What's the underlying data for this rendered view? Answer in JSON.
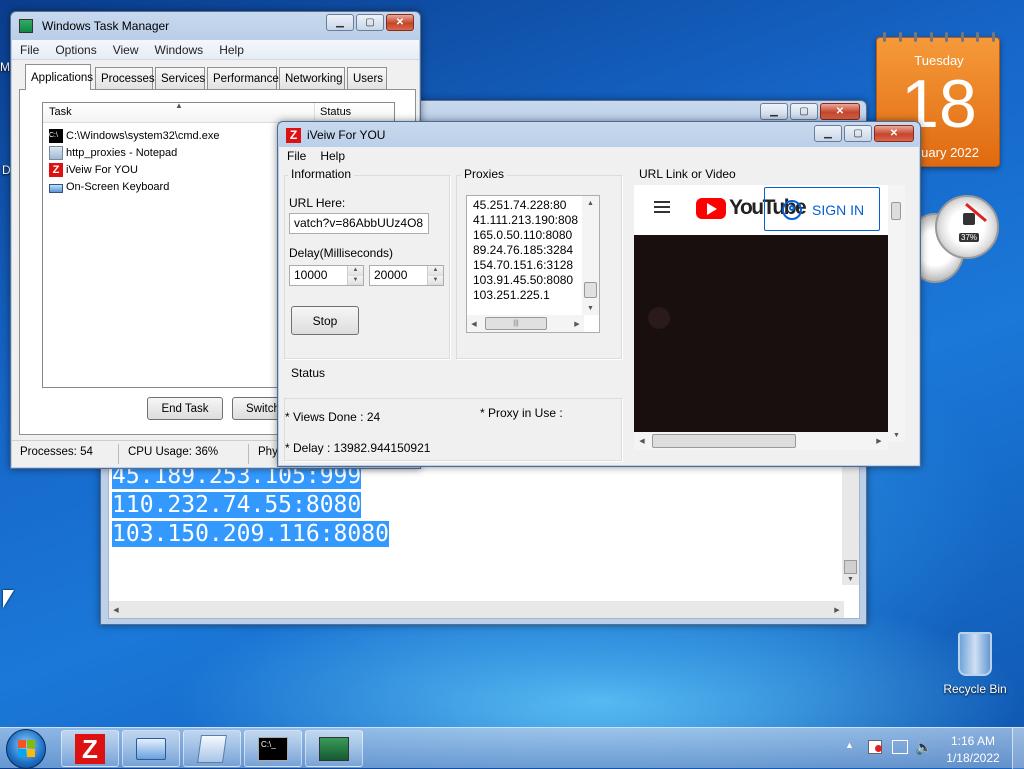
{
  "desktop": {
    "recycle_bin_label": "Recycle Bin",
    "calendar": {
      "day_name": "Tuesday",
      "day": "18",
      "month_year": "uary 2022"
    },
    "cpu_gauge_value": "37%",
    "edge_letters": [
      "M",
      "D"
    ]
  },
  "task_manager": {
    "title": "Windows Task Manager",
    "menu": [
      "File",
      "Options",
      "View",
      "Windows",
      "Help"
    ],
    "tabs": [
      "Applications",
      "Processes",
      "Services",
      "Performance",
      "Networking",
      "Users"
    ],
    "columns": {
      "task": "Task",
      "status": "Status"
    },
    "tasks": [
      "C:\\Windows\\system32\\cmd.exe",
      "http_proxies - Notepad",
      "iVeiw For YOU",
      "On-Screen Keyboard"
    ],
    "buttons": {
      "end_task": "End Task",
      "switch_to": "Switch"
    },
    "status_bar": {
      "processes": "Processes: 54",
      "cpu": "CPU Usage: 36%",
      "physical": "Phy"
    }
  },
  "notepad": {
    "lines": [
      "45.189.253.105:999",
      "110.232.74.55:8080",
      "103.150.209.116:8080"
    ]
  },
  "iview": {
    "title": "iVeiw For YOU",
    "menu": [
      "File",
      "Help"
    ],
    "information": {
      "group_label": "Information",
      "url_label": "URL Here:",
      "url_value": "vatch?v=86AbbUUz4O8",
      "delay_label": "Delay(Milliseconds)",
      "delay_min": "10000",
      "delay_max": "20000",
      "stop_button": "Stop"
    },
    "proxies": {
      "group_label": "Proxies",
      "items": [
        "45.251.74.228:80",
        "41.111.213.190:808",
        "165.0.50.110:8080",
        "89.24.76.185:3284",
        "154.70.151.6:3128",
        "103.91.45.50:8080",
        "103.251.225.1"
      ]
    },
    "video": {
      "group_label": "URL Link or Video",
      "youtube_wordmark": "YouTube",
      "sign_in": "SIGN IN"
    },
    "status": {
      "group_label": "Status",
      "views_done": "* Views Done :  24",
      "proxy_in_use": "* Proxy in Use :",
      "delay": "* Delay :  13982.944150921"
    }
  },
  "taskbar": {
    "time": "1:16 AM",
    "date": "1/18/2022"
  }
}
